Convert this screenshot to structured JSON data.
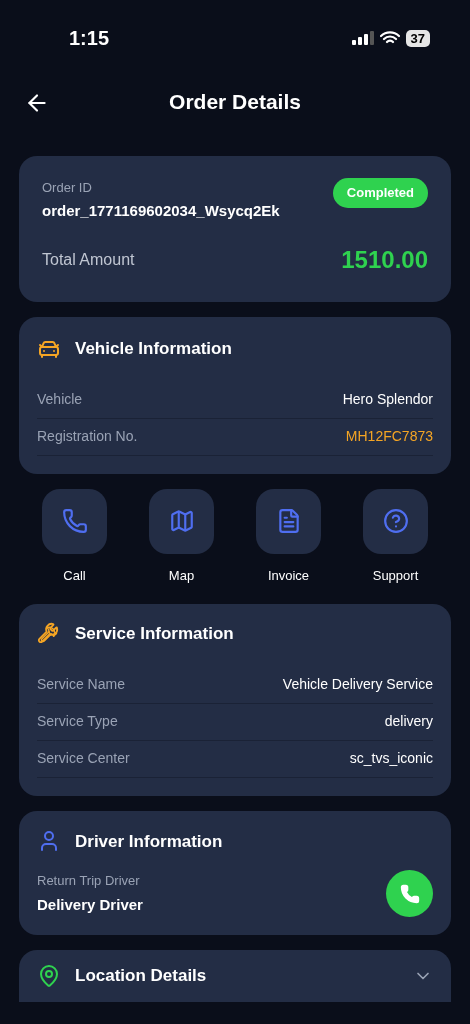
{
  "status_bar": {
    "time": "1:15",
    "battery": "37"
  },
  "header": {
    "title": "Order Details"
  },
  "order": {
    "id_label": "Order ID",
    "id": "order_1771169602034_Wsycq2Ek",
    "status": "Completed",
    "total_label": "Total Amount",
    "total": "1510.00"
  },
  "vehicle": {
    "title": "Vehicle Information",
    "rows": [
      {
        "label": "Vehicle",
        "value": "Hero Splendor",
        "highlighted": false
      },
      {
        "label": "Registration No.",
        "value": "MH12FC7873",
        "highlighted": true
      }
    ]
  },
  "actions": [
    {
      "label": "Call"
    },
    {
      "label": "Map"
    },
    {
      "label": "Invoice"
    },
    {
      "label": "Support"
    }
  ],
  "service": {
    "title": "Service Information",
    "rows": [
      {
        "label": "Service Name",
        "value": "Vehicle Delivery Service",
        "highlighted": false
      },
      {
        "label": "Service Type",
        "value": "delivery",
        "highlighted": false
      },
      {
        "label": "Service Center",
        "value": "sc_tvs_iconic",
        "highlighted": false
      }
    ]
  },
  "driver": {
    "title": "Driver Information",
    "role": "Return Trip Driver",
    "name": "Delivery Driver"
  },
  "location": {
    "title": "Location Details",
    "expanded": false
  }
}
